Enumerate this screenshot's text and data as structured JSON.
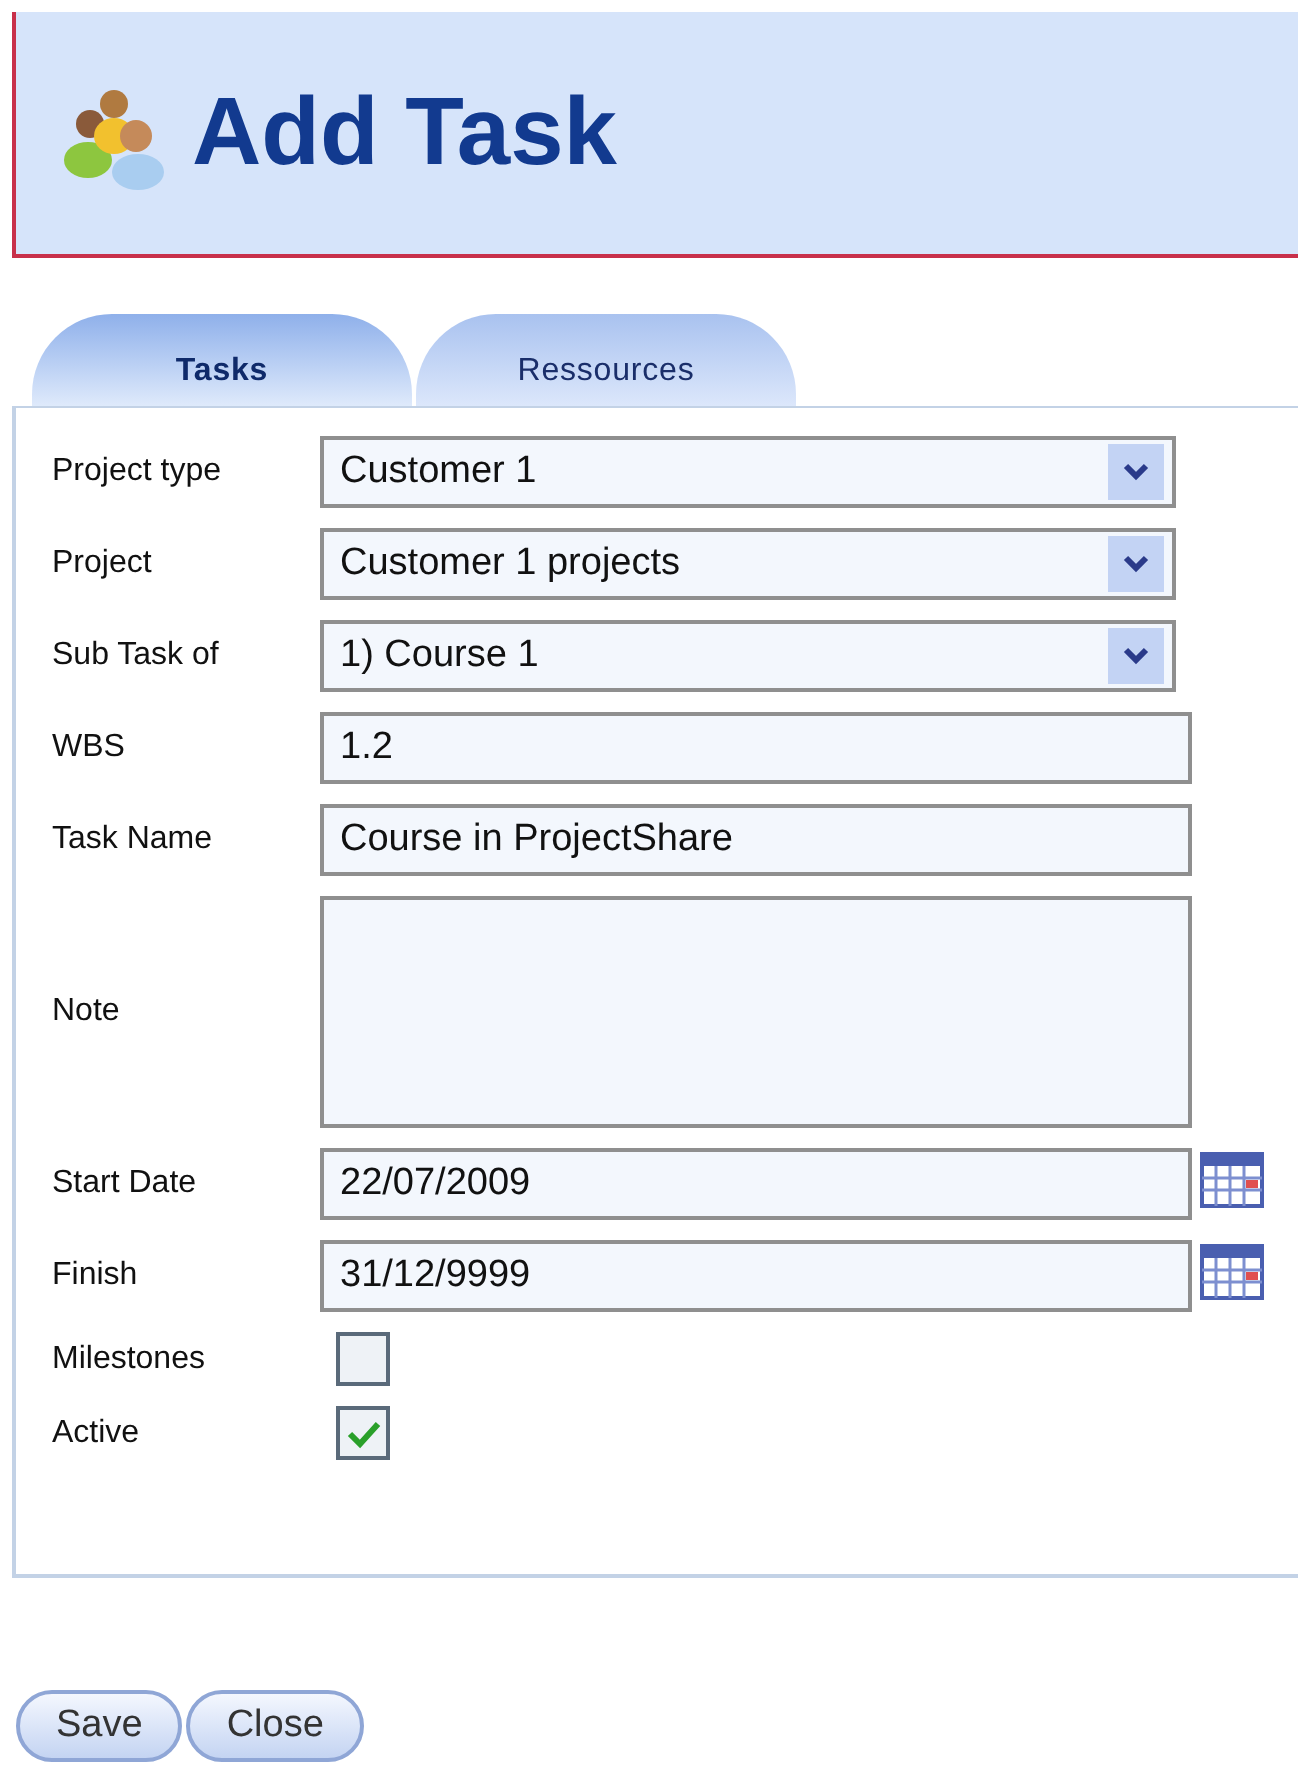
{
  "header": {
    "title": "Add Task"
  },
  "tabs": [
    {
      "label": "Tasks",
      "selected": true
    },
    {
      "label": "Ressources",
      "selected": false
    }
  ],
  "fields": [
    {
      "kind": "select",
      "label": "Project type",
      "value": "Customer 1"
    },
    {
      "kind": "select",
      "label": "Project",
      "value": "Customer 1 projects"
    },
    {
      "kind": "select",
      "label": "Sub Task of",
      "value": "1) Course 1"
    },
    {
      "kind": "text",
      "label": "WBS",
      "value": "1.2"
    },
    {
      "kind": "text",
      "label": "Task Name",
      "value": "Course in ProjectShare"
    },
    {
      "kind": "textarea",
      "label": "Note"
    },
    {
      "kind": "date",
      "label": "Start Date",
      "value": "22/07/2009"
    },
    {
      "kind": "date",
      "label": "Finish",
      "value": "31/12/9999"
    },
    {
      "kind": "checkbox",
      "label": "Milestones",
      "checked": false
    },
    {
      "kind": "checkbox",
      "label": "Active",
      "checked": true
    }
  ],
  "buttons": [
    "Save",
    "Close"
  ]
}
